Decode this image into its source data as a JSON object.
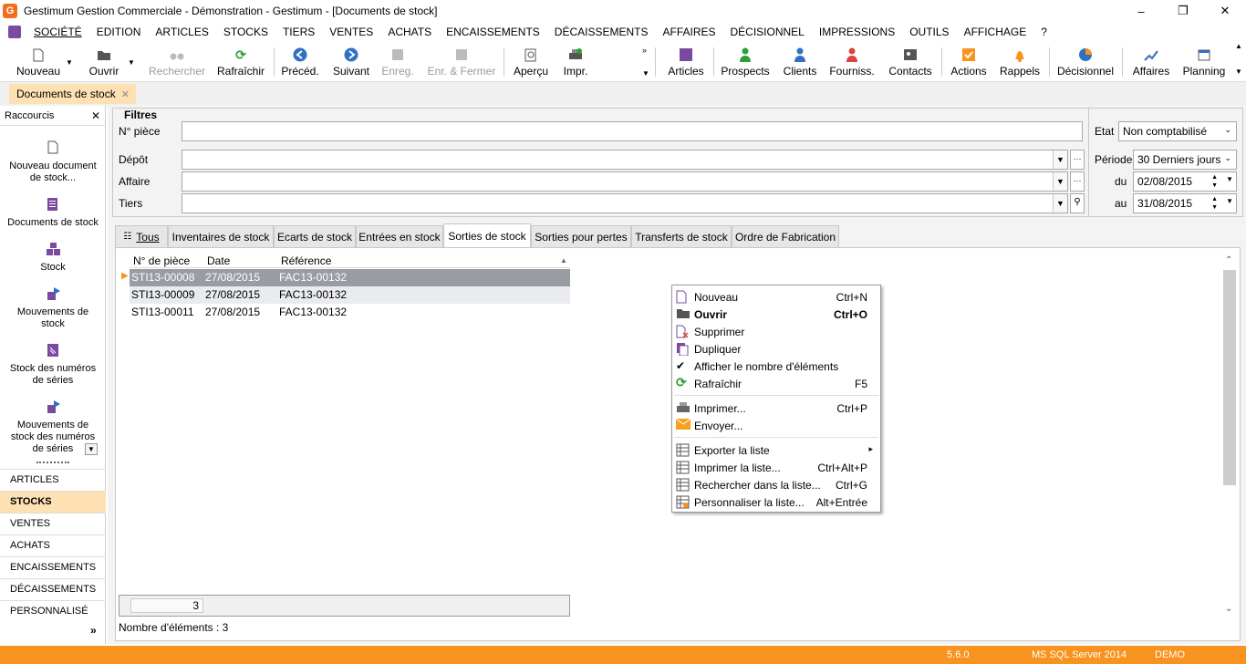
{
  "window": {
    "title": "Gestimum Gestion Commerciale - Démonstration - Gestimum - [Documents de stock]",
    "app_icon_letter": "G",
    "controls": [
      "–",
      "❐",
      "✕"
    ]
  },
  "menu": [
    "SOCIÉTÉ",
    "EDITION",
    "ARTICLES",
    "STOCKS",
    "TIERS",
    "VENTES",
    "ACHATS",
    "ENCAISSEMENTS",
    "DÉCAISSEMENTS",
    "AFFAIRES",
    "DÉCISIONNEL",
    "IMPRESSIONS",
    "OUTILS",
    "AFFICHAGE",
    "?"
  ],
  "toolbar": {
    "nouveau": "Nouveau",
    "ouvrir": "Ouvrir",
    "rechercher": "Rechercher",
    "rafraichir": "Rafraîchir",
    "preced": "Précéd.",
    "suivant": "Suivant",
    "enreg": "Enreg.",
    "enreg_fermer": "Enr. & Fermer",
    "apercu": "Aperçu",
    "impr": "Impr.",
    "articles": "Articles",
    "prospects": "Prospects",
    "clients": "Clients",
    "fourniss": "Fourniss.",
    "contacts": "Contacts",
    "actions": "Actions",
    "rappels": "Rappels",
    "decisionnel": "Décisionnel",
    "affaires": "Affaires",
    "planning": "Planning"
  },
  "doc_tab": {
    "label": "Documents de stock",
    "close": "✕"
  },
  "sidebar": {
    "header": "Raccourcis",
    "close": "✕",
    "shortcuts": [
      {
        "line1": "Nouveau document",
        "line2": "de stock..."
      },
      {
        "line1": "Documents de stock",
        "line2": ""
      },
      {
        "line1": "Stock",
        "line2": ""
      },
      {
        "line1": "Mouvements de",
        "line2": "stock"
      },
      {
        "line1": "Stock des numéros",
        "line2": "de séries"
      },
      {
        "line1": "Mouvements de",
        "line2": "stock des numéros",
        "line3": "de séries"
      }
    ],
    "categories": [
      "ARTICLES",
      "STOCKS",
      "VENTES",
      "ACHATS",
      "ENCAISSEMENTS",
      "DÉCAISSEMENTS",
      "PERSONNALISÉ"
    ],
    "more": "»"
  },
  "filters": {
    "legend": "Filtres",
    "num_piece": "N° pièce",
    "depot": "Dépôt",
    "affaire": "Affaire",
    "tiers": "Tiers",
    "etat_label": "Etat",
    "etat_value": "Non comptabilisé",
    "periode_label": "Période",
    "periode_value": "30 Derniers jours",
    "du_label": "du",
    "du_value": "02/08/2015",
    "au_label": "au",
    "au_value": "31/08/2015"
  },
  "tabs": [
    "Tous",
    "Inventaires de stock",
    "Ecarts de stock",
    "Entrées en stock",
    "Sorties de stock",
    "Sorties pour pertes",
    "Transferts de stock",
    "Ordre de Fabrication"
  ],
  "grid": {
    "headers": [
      "N° de pièce",
      "Date",
      "Référence"
    ],
    "rows": [
      [
        "STI13-00008",
        "27/08/2015",
        "FAC13-00132"
      ],
      [
        "STI13-00009",
        "27/08/2015",
        "FAC13-00132"
      ],
      [
        "STI13-00011",
        "27/08/2015",
        "FAC13-00132"
      ]
    ],
    "footer_count": "3",
    "count_label": "Nombre d'éléments : 3"
  },
  "context_menu": [
    {
      "label": "Nouveau",
      "shortcut": "Ctrl+N"
    },
    {
      "label": "Ouvrir",
      "shortcut": "Ctrl+O"
    },
    {
      "label": "Supprimer",
      "shortcut": ""
    },
    {
      "label": "Dupliquer",
      "shortcut": ""
    },
    {
      "label": "Afficher le nombre d'éléments",
      "shortcut": ""
    },
    {
      "label": "Rafraîchir",
      "shortcut": "F5"
    },
    {
      "label": "Imprimer...",
      "shortcut": "Ctrl+P"
    },
    {
      "label": "Envoyer...",
      "shortcut": ""
    },
    {
      "label": "Exporter la liste",
      "shortcut": "▸"
    },
    {
      "label": "Imprimer la liste...",
      "shortcut": "Ctrl+Alt+P"
    },
    {
      "label": "Rechercher dans la liste...",
      "shortcut": "Ctrl+G"
    },
    {
      "label": "Personnaliser la liste...",
      "shortcut": "Alt+Entrée"
    }
  ],
  "status": {
    "version": "5.6.0",
    "db": "MS SQL Server 2014",
    "mode": "DEMO"
  },
  "colors": {
    "accent_orange": "#f7931e",
    "tab_highlight": "#fde1b3",
    "selected_row": "#9a9ca3"
  }
}
